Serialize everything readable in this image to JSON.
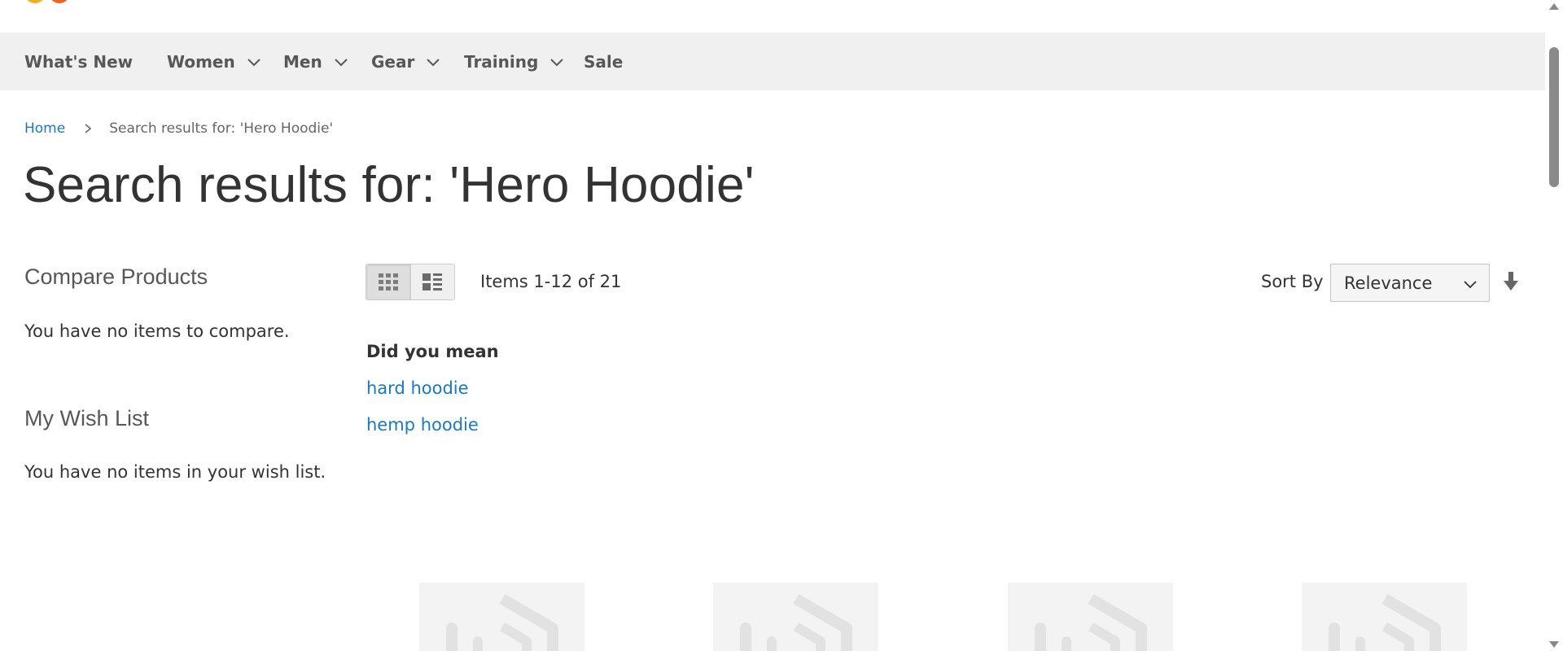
{
  "nav": {
    "items": [
      {
        "label": "What's New",
        "has_dropdown": false
      },
      {
        "label": "Women",
        "has_dropdown": true
      },
      {
        "label": "Men",
        "has_dropdown": true
      },
      {
        "label": "Gear",
        "has_dropdown": true
      },
      {
        "label": "Training",
        "has_dropdown": true
      },
      {
        "label": "Sale",
        "has_dropdown": false
      }
    ]
  },
  "breadcrumb": {
    "home": "Home",
    "current": "Search results for: 'Hero Hoodie'"
  },
  "page_title": "Search results for: 'Hero Hoodie'",
  "sidebar": {
    "compare": {
      "title": "Compare Products",
      "empty_text": "You have no items to compare."
    },
    "wishlist": {
      "title": "My Wish List",
      "empty_text": "You have no items in your wish list."
    }
  },
  "toolbar": {
    "modes": [
      {
        "name": "grid",
        "icon": "grid-icon",
        "active": true
      },
      {
        "name": "list",
        "icon": "list-icon",
        "active": false
      }
    ],
    "items_count": "Items 1-12 of 21",
    "sort_label": "Sort By",
    "sort_selected": "Relevance",
    "sort_direction_icon": "arrow-down-icon"
  },
  "suggestions": {
    "title": "Did you mean",
    "links": [
      "hard hoodie",
      "hemp hoodie"
    ]
  },
  "products": [
    {
      "image": "product-placeholder-icon"
    },
    {
      "image": "product-placeholder-icon"
    },
    {
      "image": "product-placeholder-icon"
    },
    {
      "image": "product-placeholder-icon"
    }
  ],
  "colors": {
    "link": "#1979c3",
    "nav_bg": "#f0f0f0",
    "text": "#333333",
    "logo_primary": "#f26322",
    "logo_secondary": "#f3ae1c"
  }
}
